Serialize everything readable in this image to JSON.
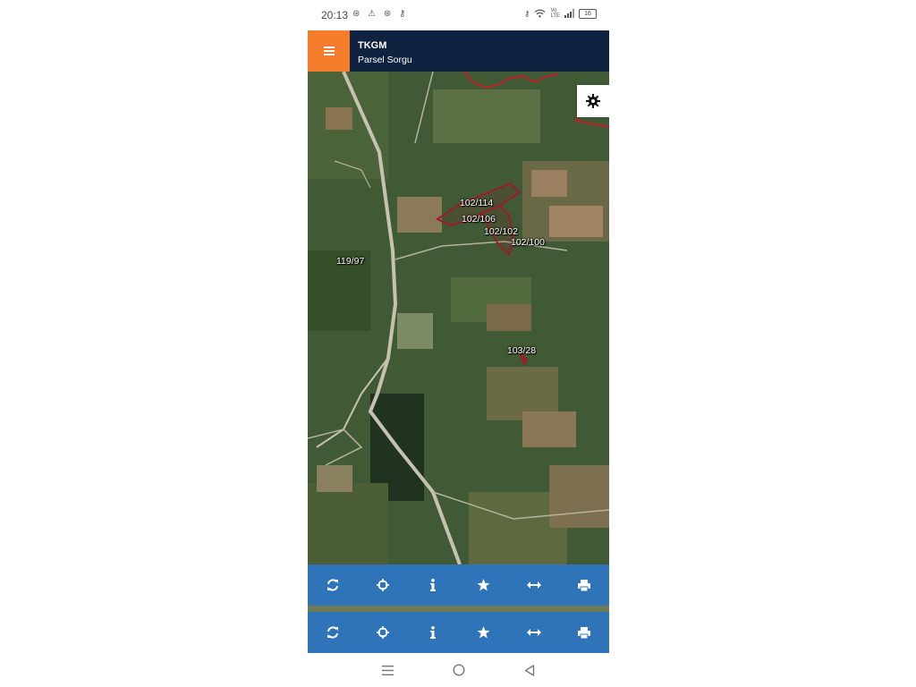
{
  "status_bar": {
    "time": "20:13",
    "left_icons": [
      "signal-app-icon",
      "warning-icon",
      "signal-app-icon",
      "key-icon"
    ],
    "right_icons": [
      "key-icon",
      "wifi-icon",
      "volte-icon",
      "cell-signal-icon"
    ],
    "battery": "16"
  },
  "app_bar": {
    "title": "TKGM",
    "subtitle": "Parsel Sorgu",
    "menu_icon": "hamburger-menu-icon",
    "accent_color": "#f47c2a",
    "bar_color": "#0f2240"
  },
  "map": {
    "settings_icon": "gear-icon",
    "parcel_color": "#9b1c2c",
    "parcels": [
      {
        "label": "102/114"
      },
      {
        "label": "102/106"
      },
      {
        "label": "102/102"
      },
      {
        "label": "102/100"
      },
      {
        "label": "119/97"
      },
      {
        "label": "103/28"
      }
    ]
  },
  "toolbar": {
    "color": "#2f73b8",
    "buttons": [
      "refresh-icon",
      "locate-icon",
      "info-icon",
      "star-icon",
      "measure-icon",
      "print-icon"
    ]
  },
  "nav_bar": {
    "buttons": [
      "recent-apps-icon",
      "home-icon",
      "back-icon"
    ]
  }
}
